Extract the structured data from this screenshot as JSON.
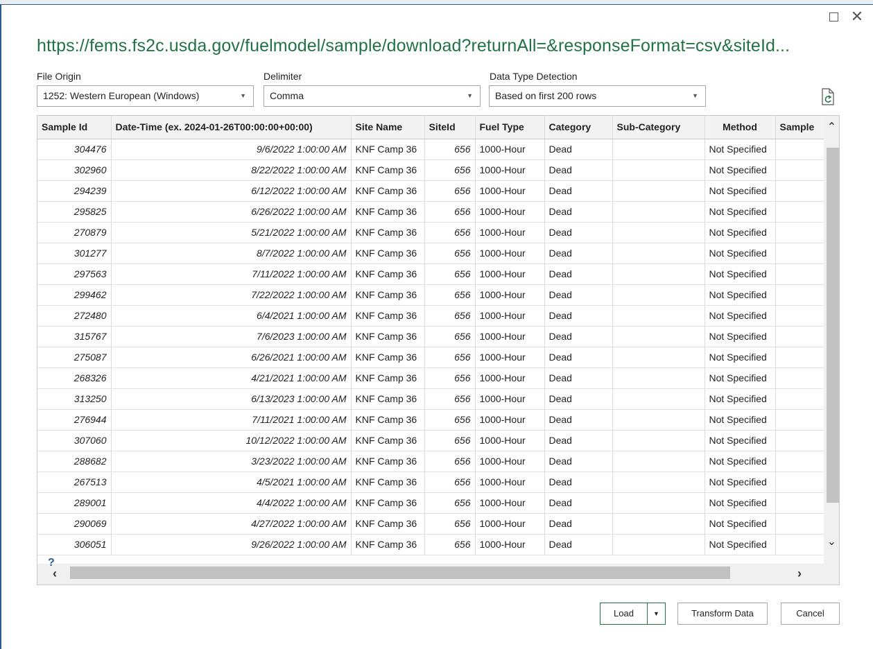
{
  "dialog": {
    "title": "https://fems.fs2c.usda.gov/fuelmodel/sample/download?returnAll=&responseFormat=csv&siteId...",
    "maximize_icon": "maximize-icon",
    "close_icon": "close-icon",
    "close_glyph": "✕"
  },
  "options": {
    "file_origin": {
      "label": "File Origin",
      "value": "1252: Western European (Windows)"
    },
    "delimiter": {
      "label": "Delimiter",
      "value": "Comma"
    },
    "data_type_detection": {
      "label": "Data Type Detection",
      "value": "Based on first 200 rows"
    },
    "refresh_icon": "refresh-preview-icon"
  },
  "table": {
    "columns": [
      "Sample Id",
      "Date-Time (ex. 2024-01-26T00:00:00+00:00)",
      "Site Name",
      "SiteId",
      "Fuel Type",
      "Category",
      "Sub-Category",
      "Method",
      "Sample"
    ],
    "rows": [
      [
        "304476",
        "9/6/2022 1:00:00 AM",
        "KNF Camp 36",
        "656",
        "1000-Hour",
        "Dead",
        "",
        "Not Specified",
        ""
      ],
      [
        "302960",
        "8/22/2022 1:00:00 AM",
        "KNF Camp 36",
        "656",
        "1000-Hour",
        "Dead",
        "",
        "Not Specified",
        ""
      ],
      [
        "294239",
        "6/12/2022 1:00:00 AM",
        "KNF Camp 36",
        "656",
        "1000-Hour",
        "Dead",
        "",
        "Not Specified",
        ""
      ],
      [
        "295825",
        "6/26/2022 1:00:00 AM",
        "KNF Camp 36",
        "656",
        "1000-Hour",
        "Dead",
        "",
        "Not Specified",
        ""
      ],
      [
        "270879",
        "5/21/2022 1:00:00 AM",
        "KNF Camp 36",
        "656",
        "1000-Hour",
        "Dead",
        "",
        "Not Specified",
        ""
      ],
      [
        "301277",
        "8/7/2022 1:00:00 AM",
        "KNF Camp 36",
        "656",
        "1000-Hour",
        "Dead",
        "",
        "Not Specified",
        ""
      ],
      [
        "297563",
        "7/11/2022 1:00:00 AM",
        "KNF Camp 36",
        "656",
        "1000-Hour",
        "Dead",
        "",
        "Not Specified",
        ""
      ],
      [
        "299462",
        "7/22/2022 1:00:00 AM",
        "KNF Camp 36",
        "656",
        "1000-Hour",
        "Dead",
        "",
        "Not Specified",
        ""
      ],
      [
        "272480",
        "6/4/2021 1:00:00 AM",
        "KNF Camp 36",
        "656",
        "1000-Hour",
        "Dead",
        "",
        "Not Specified",
        ""
      ],
      [
        "315767",
        "7/6/2023 1:00:00 AM",
        "KNF Camp 36",
        "656",
        "1000-Hour",
        "Dead",
        "",
        "Not Specified",
        ""
      ],
      [
        "275087",
        "6/26/2021 1:00:00 AM",
        "KNF Camp 36",
        "656",
        "1000-Hour",
        "Dead",
        "",
        "Not Specified",
        ""
      ],
      [
        "268326",
        "4/21/2021 1:00:00 AM",
        "KNF Camp 36",
        "656",
        "1000-Hour",
        "Dead",
        "",
        "Not Specified",
        ""
      ],
      [
        "313250",
        "6/13/2023 1:00:00 AM",
        "KNF Camp 36",
        "656",
        "1000-Hour",
        "Dead",
        "",
        "Not Specified",
        ""
      ],
      [
        "276944",
        "7/11/2021 1:00:00 AM",
        "KNF Camp 36",
        "656",
        "1000-Hour",
        "Dead",
        "",
        "Not Specified",
        ""
      ],
      [
        "307060",
        "10/12/2022 1:00:00 AM",
        "KNF Camp 36",
        "656",
        "1000-Hour",
        "Dead",
        "",
        "Not Specified",
        ""
      ],
      [
        "288682",
        "3/23/2022 1:00:00 AM",
        "KNF Camp 36",
        "656",
        "1000-Hour",
        "Dead",
        "",
        "Not Specified",
        ""
      ],
      [
        "267513",
        "4/5/2021 1:00:00 AM",
        "KNF Camp 36",
        "656",
        "1000-Hour",
        "Dead",
        "",
        "Not Specified",
        ""
      ],
      [
        "289001",
        "4/4/2022 1:00:00 AM",
        "KNF Camp 36",
        "656",
        "1000-Hour",
        "Dead",
        "",
        "Not Specified",
        ""
      ],
      [
        "290069",
        "4/27/2022 1:00:00 AM",
        "KNF Camp 36",
        "656",
        "1000-Hour",
        "Dead",
        "",
        "Not Specified",
        ""
      ],
      [
        "306051",
        "9/26/2022 1:00:00 AM",
        "KNF Camp 36",
        "656",
        "1000-Hour",
        "Dead",
        "",
        "Not Specified",
        ""
      ]
    ]
  },
  "scroll": {
    "up_icon": "chevron-up-icon",
    "down_icon": "chevron-down-icon",
    "left_icon": "chevron-left-icon",
    "right_icon": "chevron-right-icon",
    "help_icon": "help-icon"
  },
  "footer": {
    "load_label": "Load",
    "load_dropdown_icon": "chevron-down-icon",
    "transform_label": "Transform Data",
    "cancel_label": "Cancel"
  },
  "colors": {
    "accent": "#217346",
    "frame": "#2b5d8c"
  }
}
